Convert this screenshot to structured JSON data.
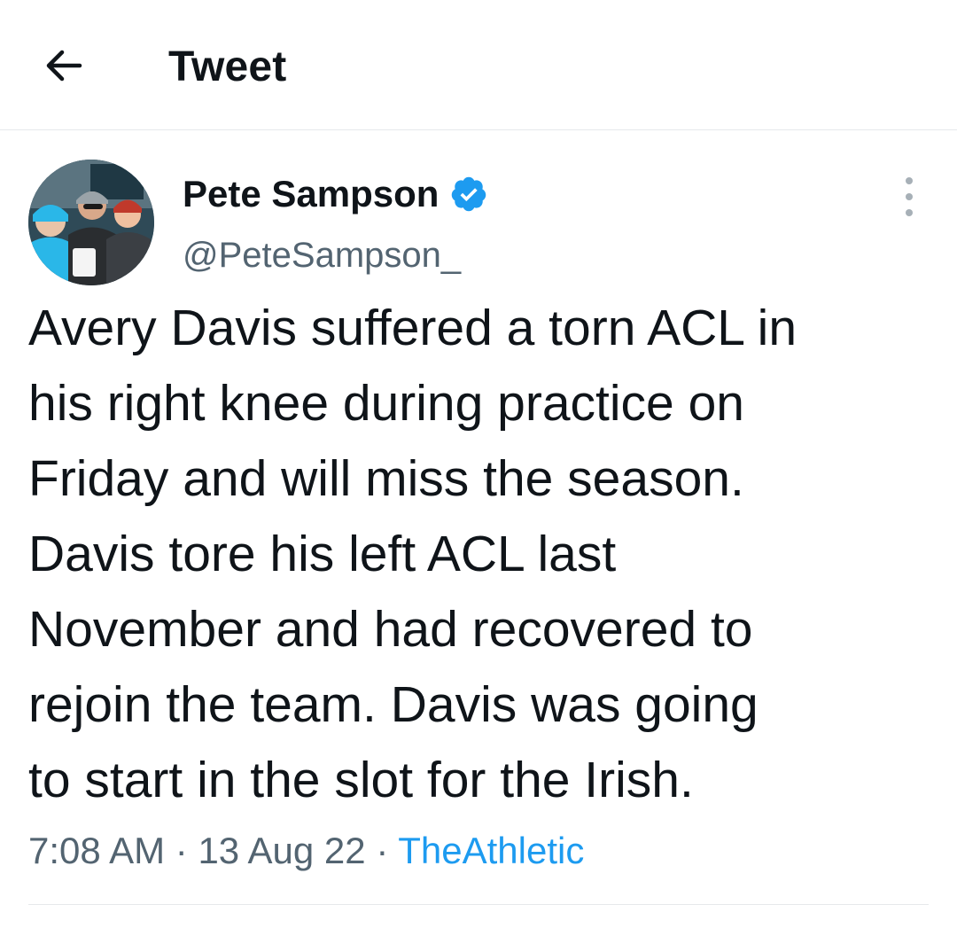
{
  "header": {
    "title": "Tweet",
    "back_icon": "arrow-left-icon"
  },
  "author": {
    "name": "Pete Sampson",
    "handle": "@PeteSampson_",
    "verified": true,
    "verified_color": "#1d9bf0"
  },
  "tweet": {
    "text": "Avery Davis suffered a torn ACL in\nhis right knee during practice on\nFriday and will miss the season.\nDavis tore his left ACL last\nNovember and had recovered to\nrejoin the team. Davis was going\nto start in the slot for the Irish.",
    "time": "7:08 AM",
    "separator": "·",
    "date": "13 Aug 22",
    "source": "TheAthletic"
  },
  "more_icon": "more-vertical-icon",
  "colors": {
    "text": "#0f1419",
    "secondary": "#536471",
    "link": "#1d9bf0",
    "divider": "#e6e9eb"
  }
}
